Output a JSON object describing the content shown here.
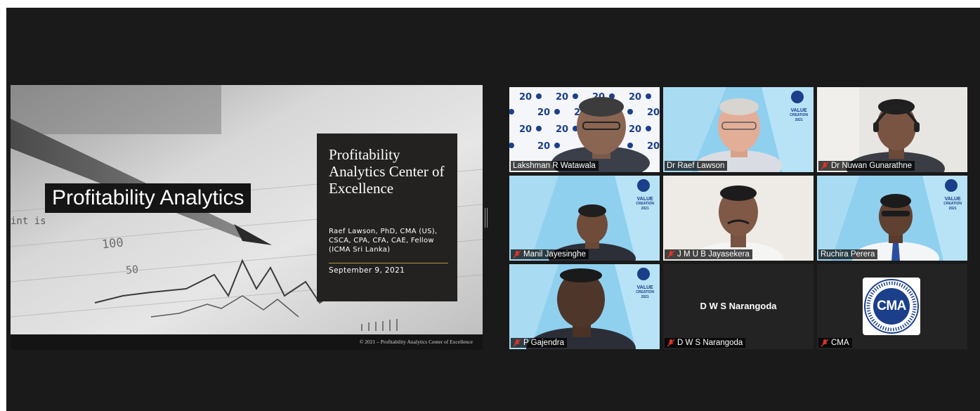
{
  "slide": {
    "title": "Profitability Analytics",
    "panel_title": "Profitability Analytics Center of Excellence",
    "panel_author": "Raef Lawson, PhD, CMA (US), CSCA, CPA, CFA, CAE, Fellow (ICMA Sri Lanka)",
    "panel_date": "September 9, 2021",
    "footer": "© 2021 – Profitability Analytics Center of Excellence",
    "chart_ticks": [
      "100",
      "50"
    ],
    "background_text": "int is"
  },
  "participants": [
    {
      "name": "Lakshman R Watawala",
      "muted": false,
      "active": false
    },
    {
      "name": "Dr Raef Lawson",
      "muted": false,
      "active": true
    },
    {
      "name": "Dr Nuwan Gunarathne",
      "muted": true,
      "active": false
    },
    {
      "name": "Manil Jayesinghe",
      "muted": true,
      "active": false
    },
    {
      "name": "J M U B Jayasekera",
      "muted": true,
      "active": false
    },
    {
      "name": "Ruchira Perera",
      "muted": false,
      "active": false
    },
    {
      "name": "P Gajendra",
      "muted": true,
      "active": false
    },
    {
      "name": "D W S Narangoda",
      "muted": true,
      "active": false,
      "video_off_label": "D W S Narangoda"
    },
    {
      "name": "CMA",
      "muted": true,
      "active": false,
      "logo_text": "CMA"
    }
  ],
  "backdrop": {
    "year_text": "20",
    "value_creation": "VALUE",
    "creation": "CREATION",
    "year": "2021",
    "logo": "CMA"
  },
  "colors": {
    "background": "#1a1a1a",
    "active_speaker": "#d8e24f",
    "mute_red": "#e0352b",
    "backdrop_blue": "#7fc8ea"
  }
}
